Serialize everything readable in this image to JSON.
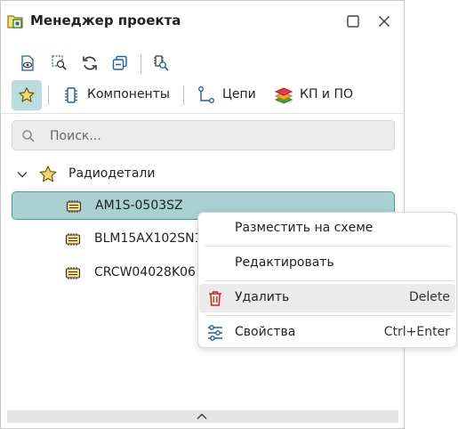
{
  "window": {
    "title": "Менеджер проекта",
    "icons": {
      "app": "project-manager-icon",
      "maximize": "maximize-icon",
      "close": "close-icon"
    }
  },
  "toolbar": {
    "buttons": [
      "view-document-icon",
      "find-icon",
      "refresh-icon",
      "collapse-icon",
      "find-component-icon"
    ]
  },
  "tabs": [
    {
      "label": "Компоненты",
      "icon": "component-icon"
    },
    {
      "label": "Цепи",
      "icon": "net-icon"
    },
    {
      "label": "КП и ПО",
      "icon": "layers-icon"
    }
  ],
  "favorites_icon": "star-icon",
  "search": {
    "placeholder": "Поиск...",
    "value": ""
  },
  "tree": {
    "root": {
      "label": "Радиодетали",
      "expanded": true
    },
    "items": [
      {
        "label": "AM1S-0503SZ",
        "selected": true
      },
      {
        "label": "BLM15AX102SN1",
        "selected": false
      },
      {
        "label": "CRCW04028K06",
        "selected": false
      }
    ]
  },
  "context_menu": {
    "items": [
      {
        "label": "Разместить на схеме",
        "shortcut": ""
      },
      {
        "label": "Редактировать",
        "shortcut": ""
      },
      {
        "label": "Удалить",
        "shortcut": "Delete",
        "icon": "trash-icon"
      },
      {
        "label": "Свойства",
        "shortcut": "Ctrl+Enter",
        "icon": "settings-sliders-icon"
      }
    ]
  },
  "colors": {
    "accent": "#4d9a9a",
    "selection": "#a9d1d1",
    "delete_icon": "#c62828",
    "cyan_icon": "#0097a7"
  }
}
